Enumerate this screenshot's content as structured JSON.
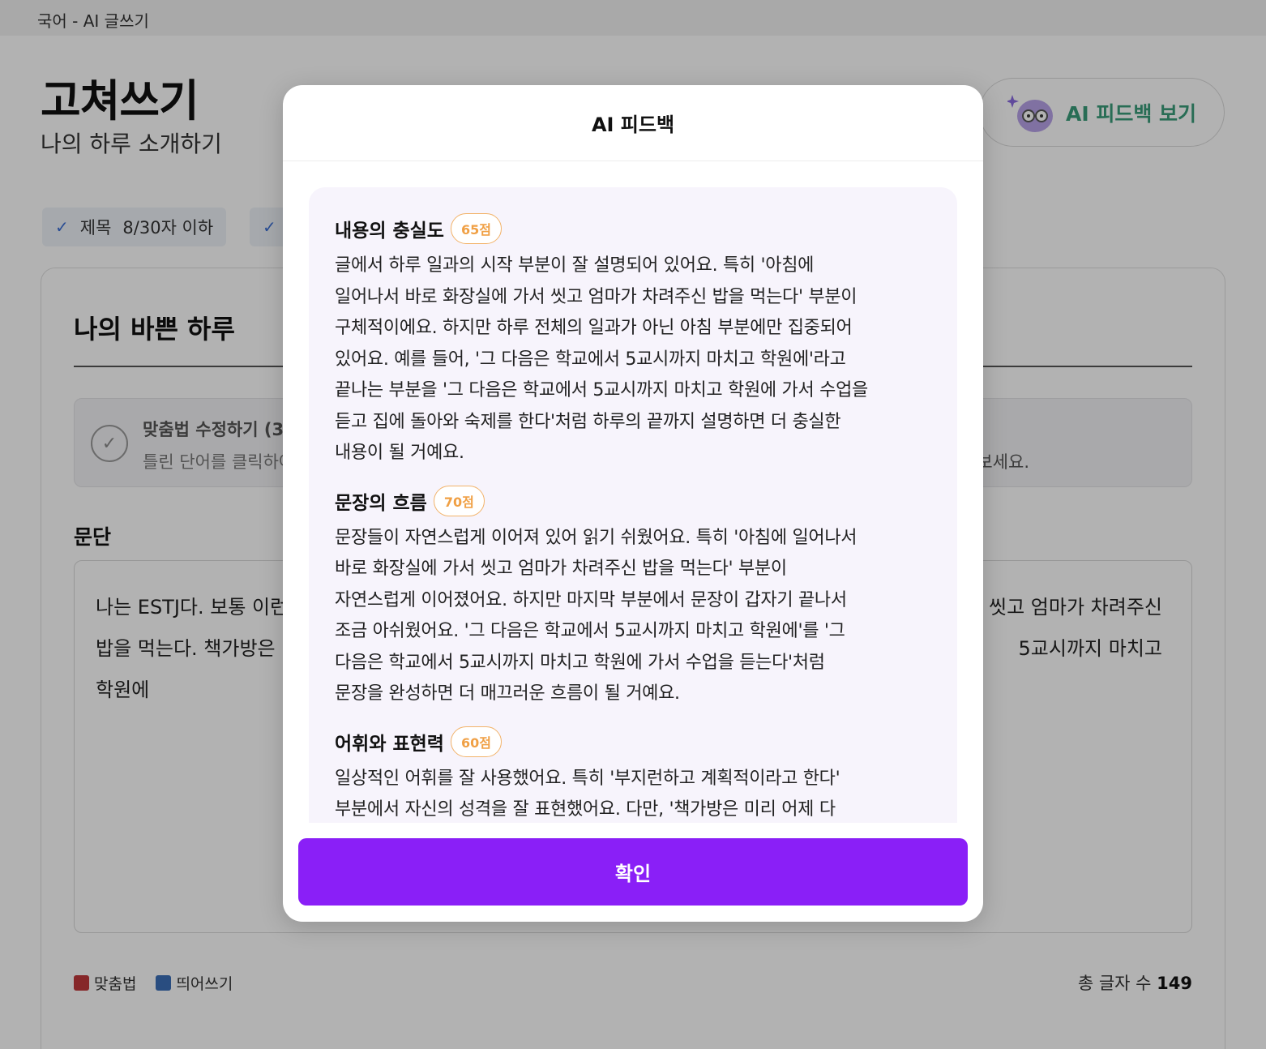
{
  "topbar": {
    "title": "국어 - AI 글쓰기"
  },
  "header": {
    "title": "고쳐쓰기",
    "subtitle": "나의 하루 소개하기"
  },
  "ai_button": {
    "label": "AI 피드백 보기",
    "icon": "mascot-icon"
  },
  "chips": [
    {
      "label": "제목",
      "value": "8/30자 이하"
    }
  ],
  "card": {
    "title": "나의 바쁜 하루",
    "notice": {
      "title": "맞춤법 수정하기 (3",
      "description": "틀린 단어를 클릭하여",
      "tail": "보세요."
    },
    "paragraph_label": "문단",
    "paragraph_left_lines": [
      "나는 ESTJ다. 보통 이런",
      "밥을 먹는다. 책가방은 미",
      "학원에"
    ],
    "paragraph_right_lines": [
      "씻고 엄마가 차려주신",
      "5교시까지 마치고"
    ],
    "legend": [
      {
        "label": "맞춤법",
        "color": "#c0393b"
      },
      {
        "label": "띄어쓰기",
        "color": "#3b6fb8"
      }
    ],
    "count_label": "총 글자 수",
    "count_value": "149"
  },
  "modal": {
    "title": "AI 피드백",
    "sections": [
      {
        "title": "내용의 충실도",
        "score": "65점",
        "lines": [
          "글에서 하루 일과의 시작 부분이 잘 설명되어 있어요. 특히 '아침에",
          "일어나서 바로 화장실에 가서 씻고 엄마가 차려주신 밥을 먹는다' 부분이",
          "구체적이에요. 하지만 하루 전체의 일과가 아닌 아침 부분에만 집중되어",
          "있어요. 예를 들어, '그 다음은 학교에서 5교시까지 마치고 학원에'라고",
          "끝나는 부분을 '그 다음은 학교에서 5교시까지 마치고 학원에 가서 수업을",
          "듣고 집에 돌아와 숙제를 한다'처럼 하루의 끝까지 설명하면 더 충실한",
          "내용이 될 거예요."
        ]
      },
      {
        "title": "문장의 흐름",
        "score": "70점",
        "lines": [
          "문장들이 자연스럽게 이어져 있어 읽기 쉬웠어요. 특히 '아침에 일어나서",
          "바로 화장실에 가서 씻고 엄마가 차려주신 밥을 먹는다' 부분이",
          "자연스럽게 이어졌어요. 하지만 마지막 부분에서 문장이 갑자기 끝나서",
          "조금 아쉬웠어요. '그 다음은 학교에서 5교시까지 마치고 학원에'를 '그",
          "다음은 학교에서 5교시까지 마치고 학원에 가서 수업을 듣는다'처럼",
          "문장을 완성하면 더 매끄러운 흐름이 될 거예요."
        ]
      },
      {
        "title": "어휘와 표현력",
        "score": "60점",
        "lines": [
          "일상적인 어휘를 잘 사용했어요. 특히 '부지런하고 계획적이라고 한다'",
          "부분에서 자신의 성격을 잘 표현했어요. 다만, '책가방은 미리 어제 다"
        ]
      }
    ],
    "confirm_label": "확인"
  }
}
